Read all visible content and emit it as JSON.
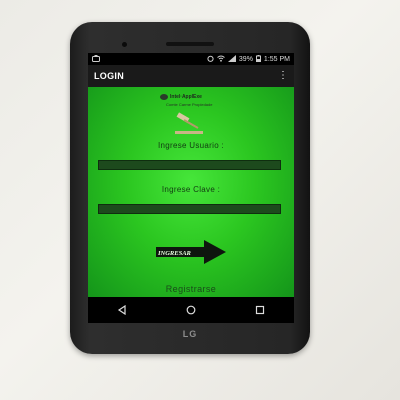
{
  "status_bar": {
    "time": "1:55 PM",
    "battery": "39%",
    "icons": [
      "notification-icon",
      "alarm-icon",
      "wifi-icon",
      "signal-icon",
      "battery-icon"
    ]
  },
  "app_bar": {
    "title": "LOGIN",
    "overflow_icon": "more-vert-icon"
  },
  "logo": {
    "title": "Intel·ApplExe",
    "subtitle": "Comte Carme Propiedade"
  },
  "form": {
    "user_label": "Ingrese Usuario :",
    "user_value": "",
    "password_label": "Ingrese Clave :",
    "password_value": "",
    "submit_label": "INGRESAR",
    "register_link": "Registrarse"
  },
  "nav_bar": {
    "icons": [
      "back-icon",
      "home-icon",
      "recents-icon"
    ]
  },
  "device": {
    "brand": "LG"
  },
  "colors": {
    "screen_green": "#2bc620",
    "field_dark": "#1d4a1d",
    "app_bar": "#1a1a1a"
  }
}
